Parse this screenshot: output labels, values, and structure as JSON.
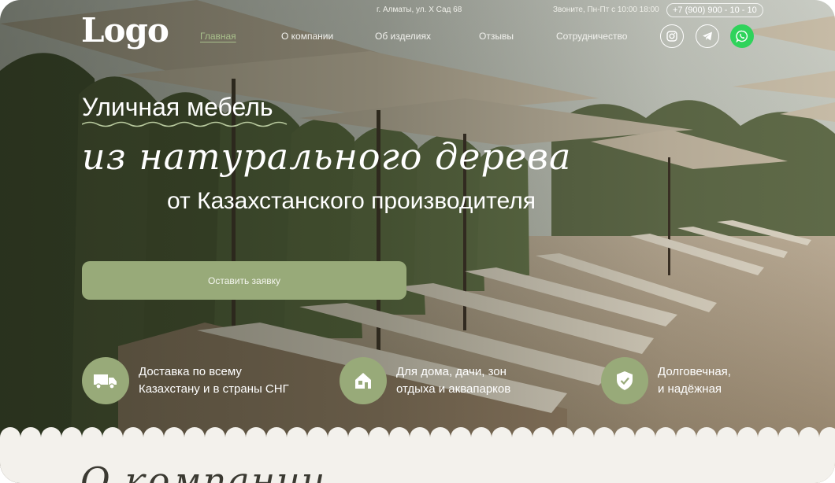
{
  "brand": {
    "logo": "Logo"
  },
  "topbar": {
    "address": "г. Алматы, ул. Х Сад 68",
    "hours": "Звоните, Пн-Пт с 10:00 18:00",
    "phone": "+7 (900) 900 - 10 - 10"
  },
  "nav": {
    "items": [
      {
        "label": "Главная",
        "active": true
      },
      {
        "label": "О компании",
        "active": false
      },
      {
        "label": "Об изделиях",
        "active": false
      },
      {
        "label": "Отзывы",
        "active": false
      },
      {
        "label": "Сотрудничество",
        "active": false
      }
    ]
  },
  "social": [
    {
      "name": "instagram-icon"
    },
    {
      "name": "telegram-icon"
    },
    {
      "name": "whatsapp-icon"
    }
  ],
  "hero": {
    "line1": "Уличная мебель",
    "line2": "из натурального дерева",
    "line3": "от Казахстанского производителя",
    "cta": "Оставить заявку"
  },
  "features": [
    {
      "icon": "truck-icon",
      "text": "Доставка по всему\nКазахстану и в страны СНГ"
    },
    {
      "icon": "house-icon",
      "text": "Для дома, дачи, зон\nотдыха и аквапарков"
    },
    {
      "icon": "shield-check-icon",
      "text": "Долговечная,\nи надёжная"
    }
  ],
  "next_section": {
    "title": "О компании"
  },
  "colors": {
    "accent": "#98aa79",
    "accent_active": "#a9c08c",
    "whatsapp": "#2fd35b",
    "section_bg": "#f3f1ec"
  }
}
